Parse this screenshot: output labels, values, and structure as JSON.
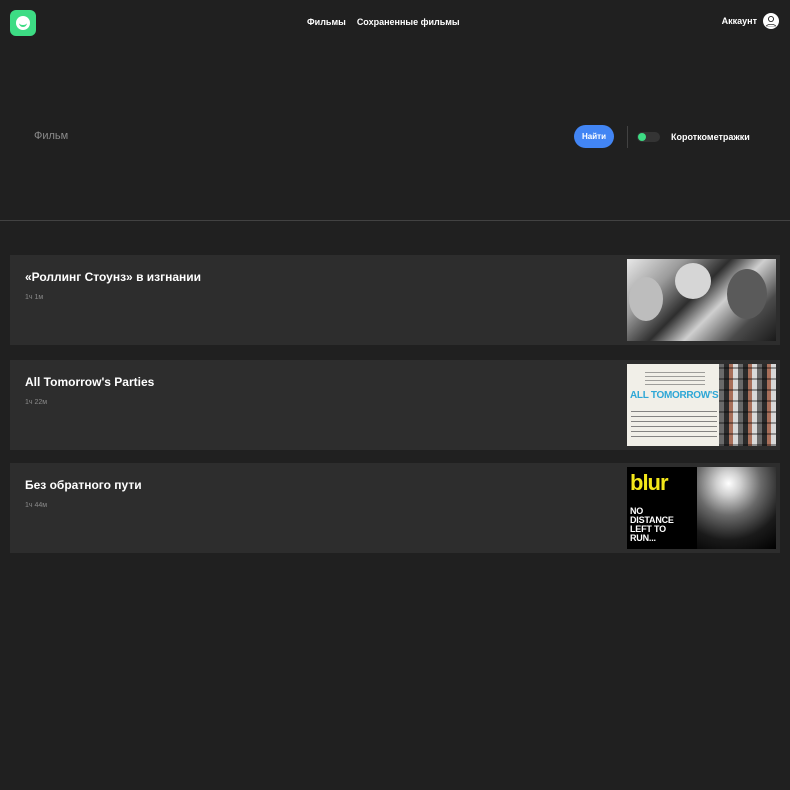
{
  "header": {
    "logo": "smile-logo",
    "nav": [
      "Фильмы",
      "Сохраненные фильмы"
    ],
    "account_label": "Аккаунт",
    "account_icon": "user-icon"
  },
  "search": {
    "placeholder": "Фильм",
    "button_label": "Найти",
    "shorts_toggle": {
      "label": "Короткометражки",
      "on": true
    }
  },
  "colors": {
    "background": "#202020",
    "card": "#2d2d2d",
    "accent_blue": "#4285f4",
    "accent_green": "#3ddc84"
  },
  "movies": [
    {
      "title": "«Роллинг Стоунз» в изгнании",
      "duration": "1ч 1м"
    },
    {
      "title": "All Tomorrow's Parties",
      "duration": "1ч 22м",
      "poster_text": "ALL TOMORROW'S PARTIES"
    },
    {
      "title": "Без обратного пути",
      "duration": "1ч 44м",
      "poster_band": "blur",
      "poster_tagline": "NO\nDISTANCE\nLEFT TO\nRUN..."
    }
  ]
}
